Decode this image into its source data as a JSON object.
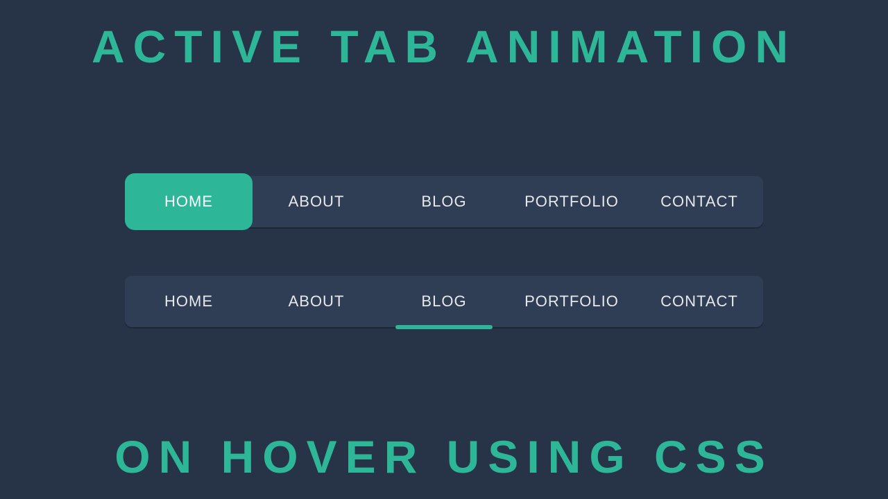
{
  "colors": {
    "background": "#273448",
    "accent": "#2db798",
    "navBg": "#2f3e54",
    "text": "#e6e8ec"
  },
  "headings": {
    "top": "ACTIVE TAB ANIMATION",
    "bottom": "ON HOVER USING CSS"
  },
  "nav1": {
    "style": "pill",
    "activeIndex": 0,
    "items": [
      "HOME",
      "ABOUT",
      "BLOG",
      "PORTFOLIO",
      "CONTACT"
    ]
  },
  "nav2": {
    "style": "underline",
    "activeIndex": 2,
    "items": [
      "HOME",
      "ABOUT",
      "BLOG",
      "PORTFOLIO",
      "CONTACT"
    ]
  }
}
